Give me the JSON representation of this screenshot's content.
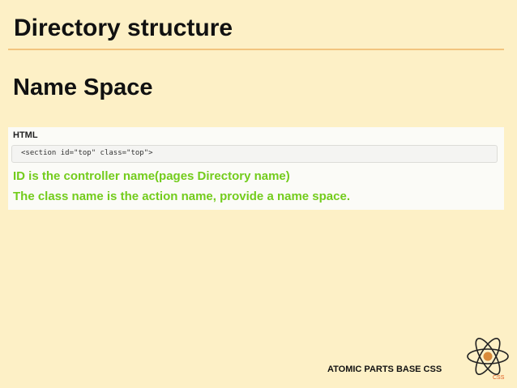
{
  "slide": {
    "title": "Directory structure",
    "subtitle": "Name Space",
    "snippet": {
      "label": "HTML",
      "code": "<section id=\"top\" class=\"top\">"
    },
    "lines": [
      "ID is the controller name(pages Directory name)",
      "The class name is the action name, provide a name space."
    ],
    "footer": "ATOMIC PARTS BASE CSS",
    "logo": {
      "text": "CSS",
      "icon": "atom-icon"
    },
    "colors": {
      "background": "#fdf0c6",
      "rule": "#f2c47e",
      "highlight": "#73cc1c",
      "logo_accent": "#e05a1e"
    }
  }
}
